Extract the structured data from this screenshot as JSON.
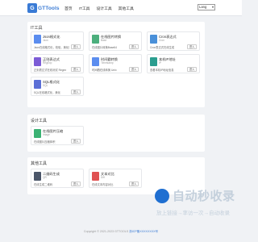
{
  "header": {
    "logo_mark": "G",
    "logo_text": "GTTools",
    "nav": [
      "首页",
      "IT工具",
      "设计工具",
      "其他工具"
    ],
    "lang": "Lang"
  },
  "sections": [
    {
      "title": "IT工具",
      "cards": [
        {
          "name": "Json格式化",
          "sub": "Json",
          "desc": "Json在线格式化，校验，美化压缩",
          "btn": "进入",
          "color": "#5b8def",
          "icon": "json-icon"
        },
        {
          "name": "在线图片转换",
          "sub": "Base",
          "desc": "在线图片转换Base64",
          "btn": "进入",
          "color": "#4caf7d",
          "icon": "image-icon"
        },
        {
          "name": "Cron表达式",
          "sub": "Cron",
          "desc": "Cron表达式在线生成",
          "btn": "进入",
          "color": "#4a90d9",
          "icon": "cron-icon"
        },
        {
          "name": "正则表达式",
          "sub": "RegExp",
          "desc": "正则表达式在线测试 Regex",
          "btn": "进入",
          "color": "#7c5cd6",
          "icon": "regex-icon"
        },
        {
          "name": "时间戳转换",
          "sub": "Timestamp",
          "desc": "时间戳在线转换 Unix",
          "btn": "进入",
          "color": "#5b8def",
          "icon": "clock-icon"
        },
        {
          "name": "本机IP地址",
          "sub": "IP",
          "desc": "查看本机IP地址信息",
          "btn": "进入",
          "color": "#2a9d8f",
          "icon": "location-icon"
        },
        {
          "name": "SQL格式化",
          "sub": "SQL",
          "desc": "SQL在线格式化，美化",
          "btn": "进入",
          "color": "#5b6fd6",
          "icon": "sql-icon"
        }
      ]
    },
    {
      "title": "设计工具",
      "cards": [
        {
          "name": "在线图片压缩",
          "sub": "Image",
          "desc": "在线图片压缩体积",
          "btn": "进入",
          "color": "#3bb273",
          "icon": "compress-icon"
        }
      ]
    },
    {
      "title": "其他工具",
      "cards": [
        {
          "name": "二维码生成",
          "sub": "QR",
          "desc": "在线生成二维码",
          "btn": "进入",
          "color": "#4a5568",
          "icon": "qrcode-icon"
        },
        {
          "name": "文本对比",
          "sub": "Diff",
          "desc": "在线文本内容对比",
          "btn": "进入",
          "color": "#e05252",
          "icon": "pdf-icon"
        }
      ]
    }
  ],
  "footer": {
    "copyright": "Copyright © 2021-2023 GTTOOLS",
    "icp": "浙ICP备XXXXXXXX号"
  },
  "watermark": {
    "text": "自动秒收录",
    "slogan": "放上链接→率访一次→自动收录"
  }
}
